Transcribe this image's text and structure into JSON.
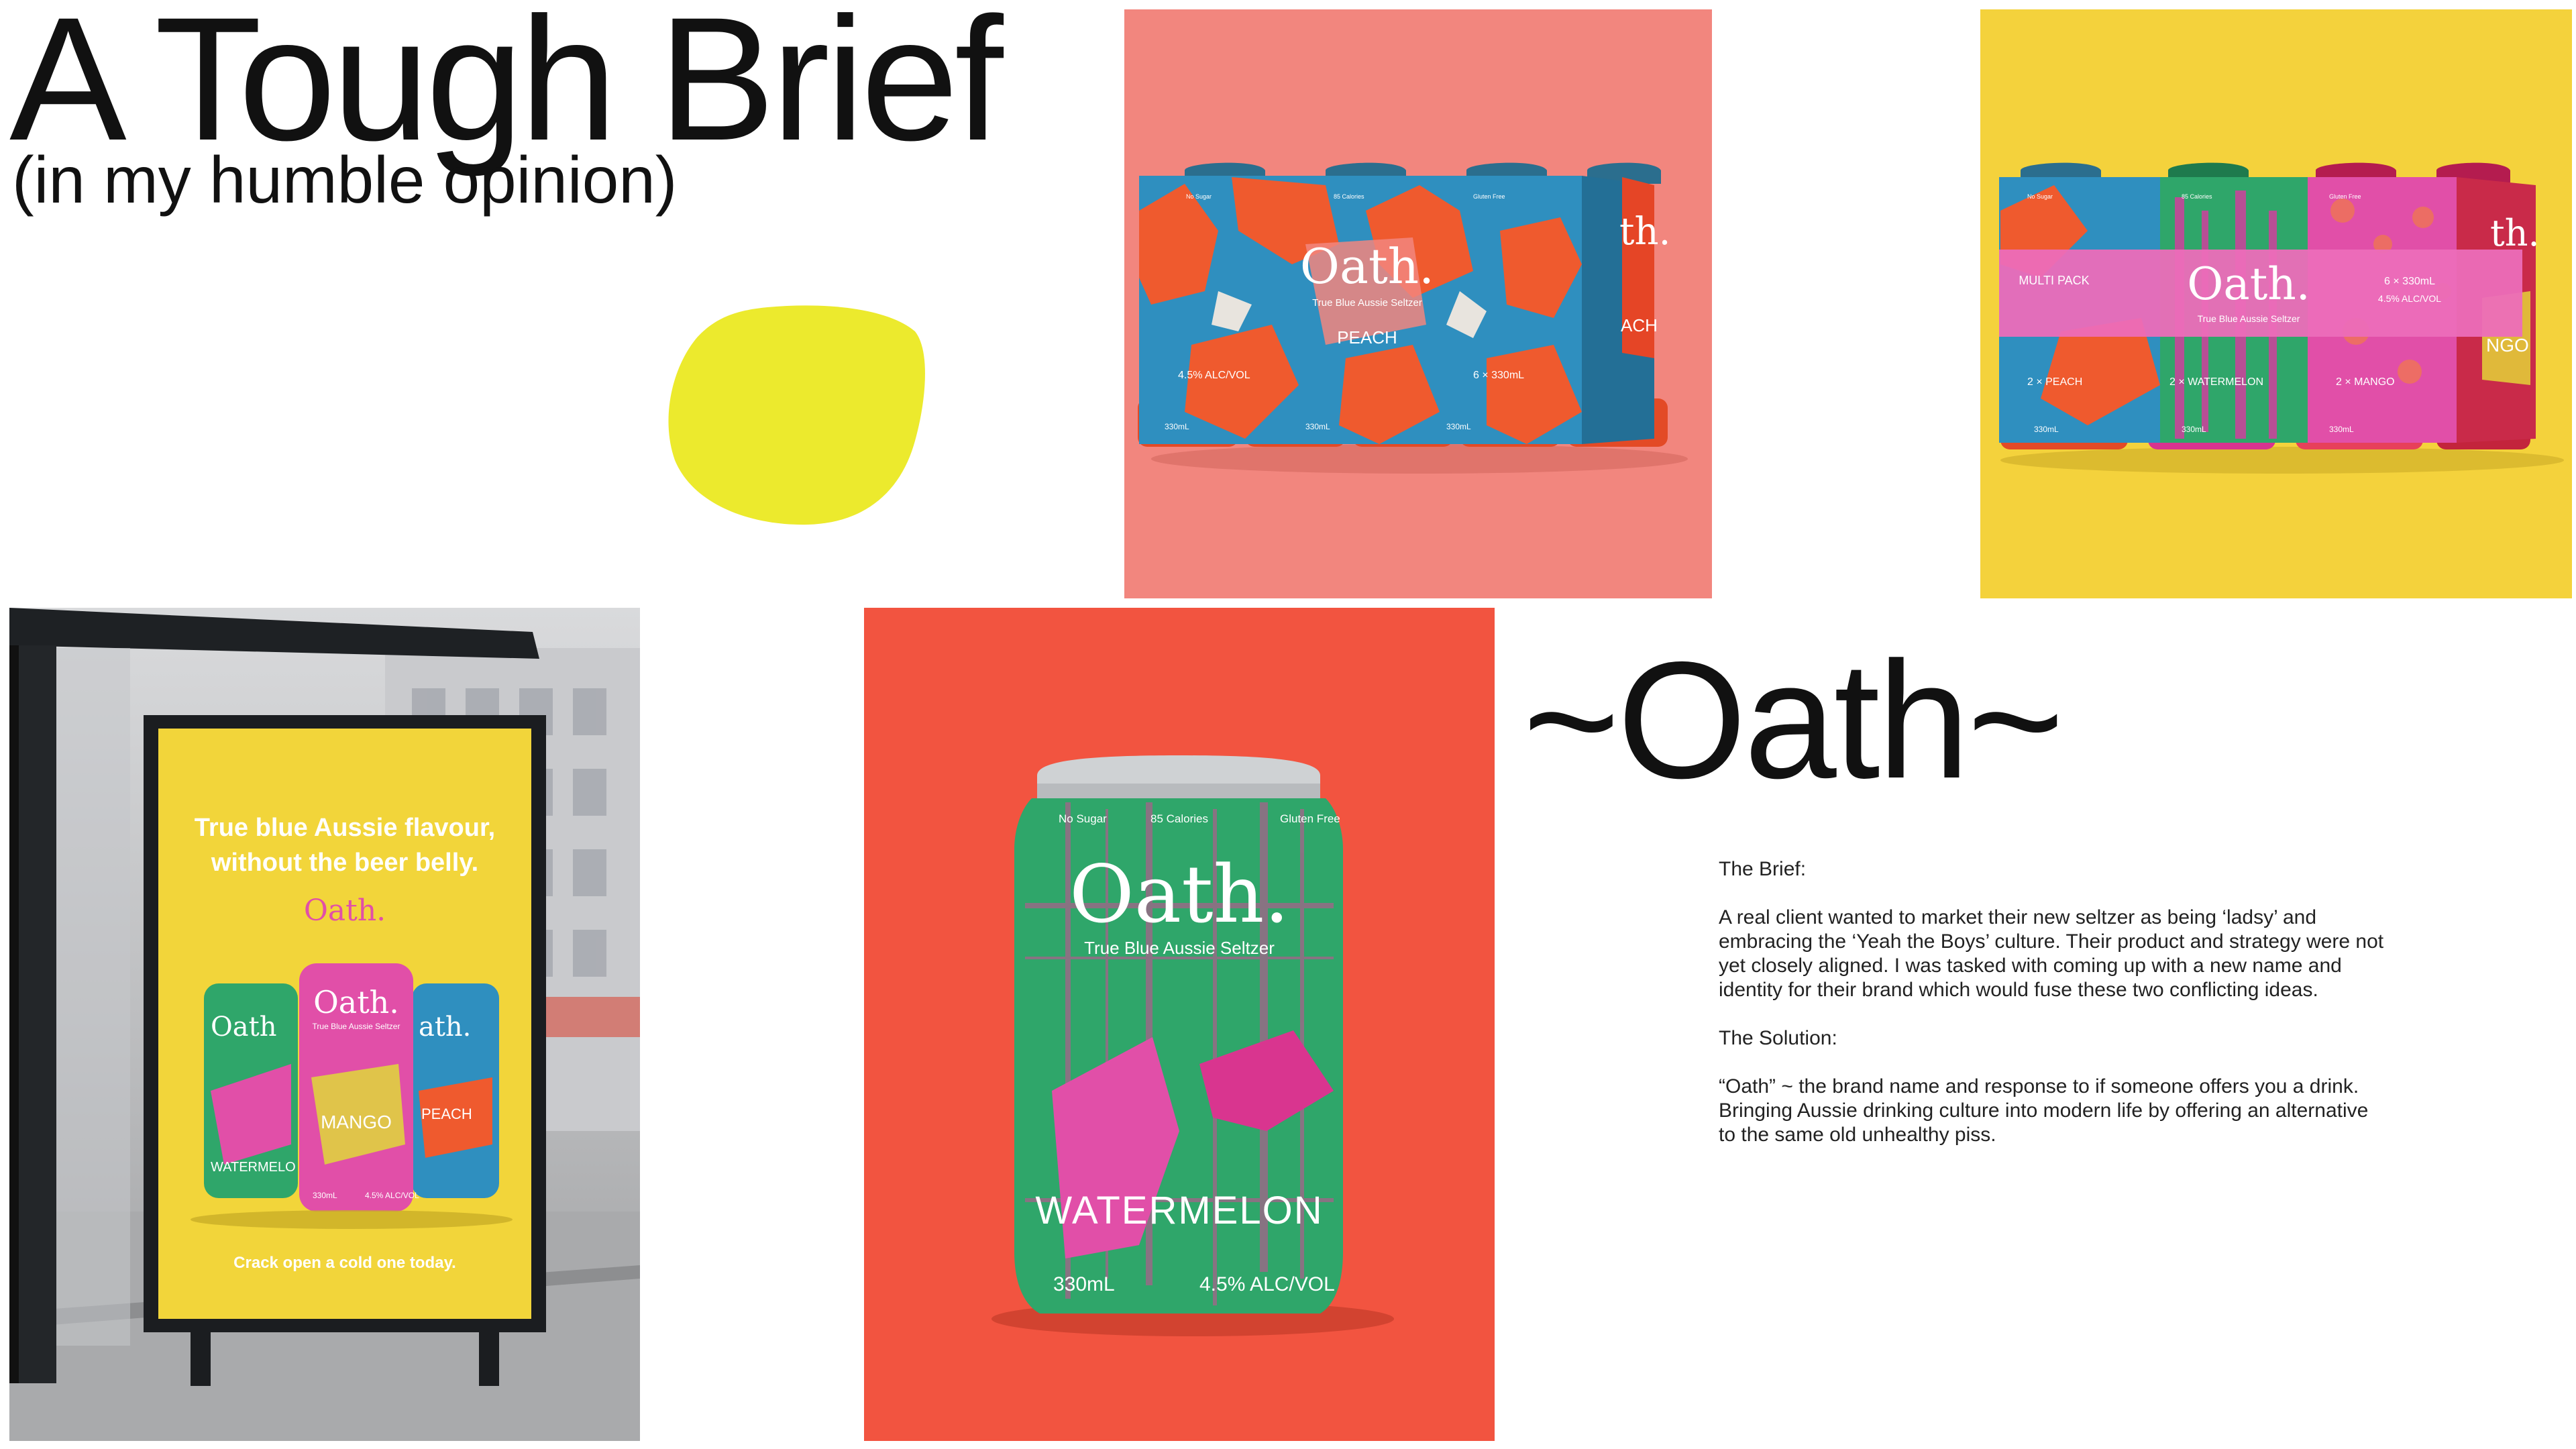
{
  "header": {
    "title": "A Tough Brief",
    "subtitle": "(in my humble opinion)"
  },
  "colors": {
    "blob": "#ECEA2D",
    "peach_bg": "#F2867E",
    "multipack_bg": "#F4D23C",
    "melon_bg": "#F25440",
    "poster_yellow": "#F2D53A",
    "can_green": "#2FA66A",
    "can_pink": "#E14FA8",
    "can_blue": "#2F8FBF",
    "can_orange": "#EF5A2E"
  },
  "pack_peach": {
    "brand": "Oath.",
    "tagline": "True Blue Aussie Seltzer",
    "flavour": "PEACH",
    "tab_left": "No Sugar",
    "tab_mid": "85 Calories",
    "tab_right": "Gluten Free",
    "abv": "4.5% ALC/VOL",
    "count": "6 × 330mL",
    "side_partial": "th.",
    "side_flavour": "ACH",
    "can_labels": [
      "330mL",
      "330mL",
      "330mL"
    ]
  },
  "pack_multi": {
    "brand": "Oath.",
    "tagline": "True Blue Aussie Seltzer",
    "left_label": "MULTI PACK",
    "count": "6 × 330mL",
    "abv": "4.5% ALC/VOL",
    "tab_left": "No Sugar",
    "tab_mid": "85 Calories",
    "tab_right": "Gluten Free",
    "row_1": "2 × PEACH",
    "row_2": "2 × WATERMELON",
    "row_3": "2 × MANGO",
    "side_partial": "th.",
    "side_flavour": "NGO",
    "can_labels": [
      "330mL",
      "330mL",
      "330mL"
    ]
  },
  "poster": {
    "headline_1": "True blue Aussie flavour,",
    "headline_2": "without the beer belly.",
    "brand": "Oath.",
    "footer": "Crack open a cold one today.",
    "can_left_brand": "Oath",
    "can_left_flavour": "WATERMELO",
    "can_mid_brand": "Oath.",
    "can_mid_tagline": "True Blue Aussie Seltzer",
    "can_mid_flavour": "MANGO",
    "can_right_brand": "ath.",
    "can_right_flavour": "PEACH",
    "can_size": "330mL",
    "can_abv": "4.5% ALC/VOL"
  },
  "can_hero": {
    "tab_left": "No Sugar",
    "tab_mid": "85 Calories",
    "tab_right": "Gluten Free",
    "brand": "Oath.",
    "tagline": "True Blue Aussie Seltzer",
    "flavour": "WATERMELON",
    "size": "330mL",
    "abv": "4.5% ALC/VOL"
  },
  "oath_heading": "~Oath~",
  "brief": {
    "brief_heading": "The Brief:",
    "brief_body": "A real client wanted to market their new seltzer as being ‘ladsy’ and embracing the ‘Yeah the Boys’ culture. Their product and strategy were not yet closely aligned. I was tasked with coming up with a new name and identity for their brand which would fuse these two conflicting ideas.",
    "solution_heading": "The Solution:",
    "solution_body": "“Oath” ~ the brand name and response to if someone offers you a drink. Bringing Aussie drinking culture into modern life by offering an alternative to the same old unhealthy piss."
  }
}
